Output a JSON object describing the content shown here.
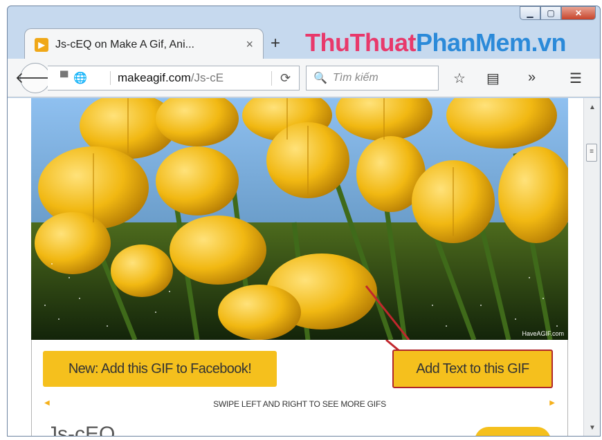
{
  "browser": {
    "tab_title": "Js-cEQ on Make A Gif, Ani...",
    "tab_close": "×",
    "new_tab": "+",
    "brand_part1": "ThuThuat",
    "brand_part2": "PhanMem.vn",
    "url_domain": "makeagif.com",
    "url_path": "/Js-cE",
    "search_placeholder": "Tìm kiếm",
    "window_controls": [
      "▭",
      "▢",
      "✕"
    ]
  },
  "page": {
    "facebook_button": "New: Add this GIF to Facebook!",
    "add_text_button": "Add Text to this GIF",
    "swipe_hint": "SWIPE LEFT AND RIGHT TO SEE MORE GIFS",
    "gif_name": "Js-cEQ",
    "image_watermark": "HaveAGIF.com"
  },
  "colors": {
    "accent_yellow": "#f5c01d",
    "highlight_red": "#b0262a",
    "brand_pink": "#e8396b",
    "brand_blue": "#2b8ad9"
  }
}
